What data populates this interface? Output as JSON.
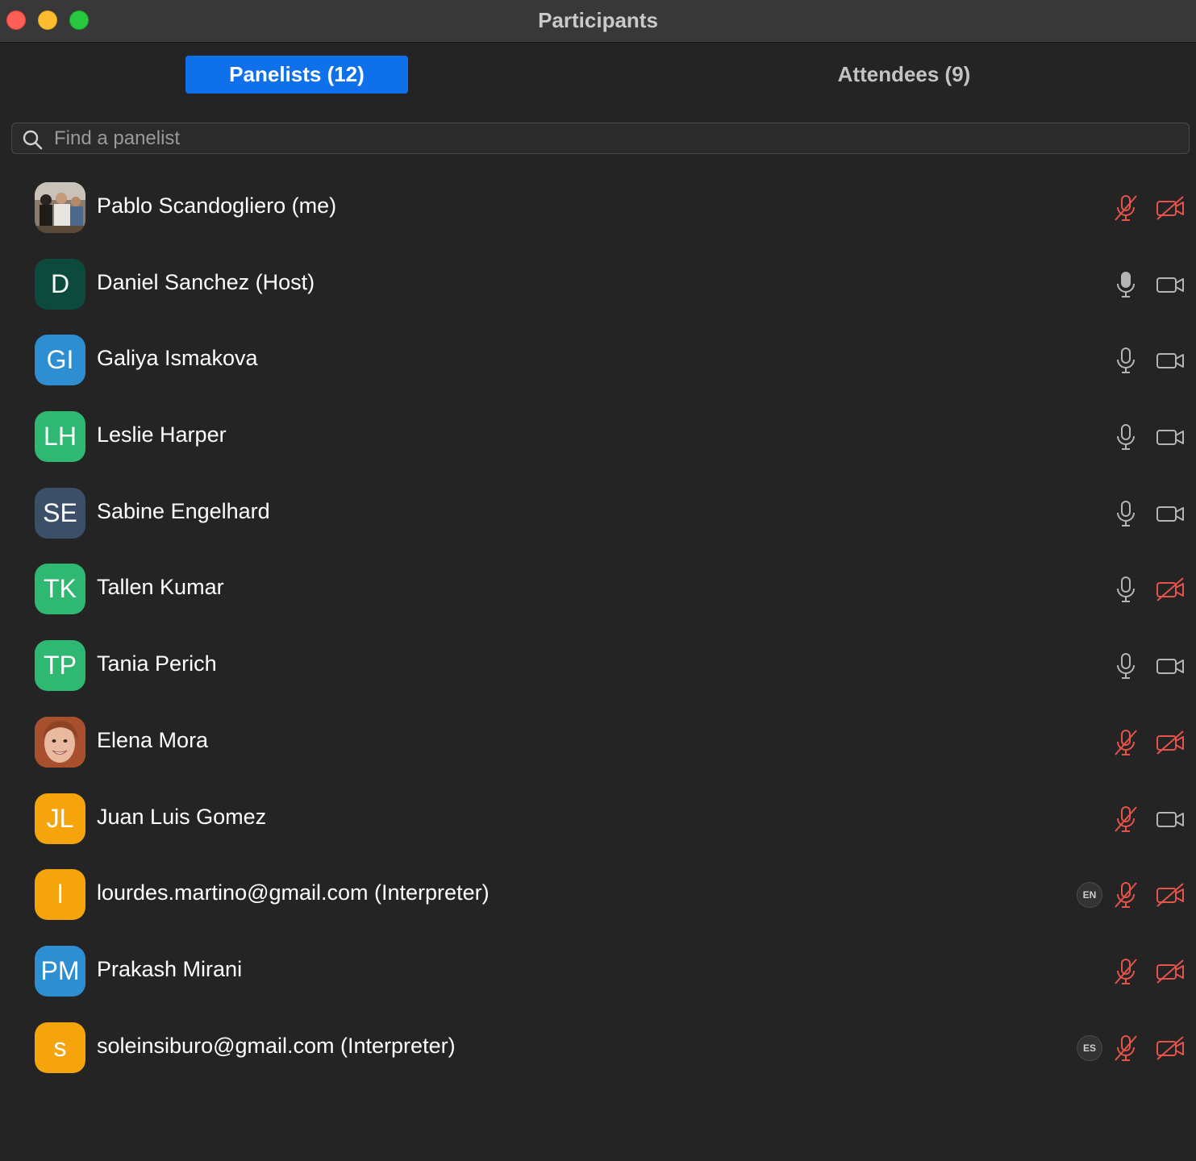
{
  "window": {
    "title": "Participants"
  },
  "tabs": {
    "panelists": "Panelists (12)",
    "attendees": "Attendees (9)"
  },
  "search": {
    "placeholder": "Find a panelist",
    "value": ""
  },
  "colors": {
    "accent": "#0e71eb",
    "muted_red": "#e5534b",
    "icon_gray": "#b5b5b5"
  },
  "participants": [
    {
      "name": "Pablo Scandogliero (me)",
      "avatar": "photo",
      "initials": "",
      "avatar_color": "",
      "mic_muted": true,
      "video_off": true,
      "language": ""
    },
    {
      "name": "Daniel Sanchez (Host)",
      "avatar": "initials",
      "initials": "D",
      "avatar_color": "#0b4a3d",
      "mic_muted": false,
      "mic_active": true,
      "video_off": false,
      "language": ""
    },
    {
      "name": "Galiya Ismakova",
      "avatar": "initials",
      "initials": "GI",
      "avatar_color": "#2d8fd1",
      "mic_muted": false,
      "video_off": false,
      "language": ""
    },
    {
      "name": "Leslie Harper",
      "avatar": "initials",
      "initials": "LH",
      "avatar_color": "#2eb872",
      "mic_muted": false,
      "video_off": false,
      "language": ""
    },
    {
      "name": "Sabine Engelhard",
      "avatar": "initials",
      "initials": "SE",
      "avatar_color": "#3b5068",
      "mic_muted": false,
      "video_off": false,
      "language": ""
    },
    {
      "name": "Tallen Kumar",
      "avatar": "initials",
      "initials": "TK",
      "avatar_color": "#2eb872",
      "mic_muted": false,
      "video_off": true,
      "language": ""
    },
    {
      "name": "Tania Perich",
      "avatar": "initials",
      "initials": "TP",
      "avatar_color": "#2eb872",
      "mic_muted": false,
      "video_off": false,
      "language": ""
    },
    {
      "name": "Elena Mora",
      "avatar": "photo",
      "initials": "",
      "avatar_color": "",
      "mic_muted": true,
      "video_off": true,
      "language": ""
    },
    {
      "name": "Juan Luis Gomez",
      "avatar": "initials",
      "initials": "JL",
      "avatar_color": "#f5a50b",
      "mic_muted": true,
      "video_off": false,
      "language": ""
    },
    {
      "name": "lourdes.martino@gmail.com (Interpreter)",
      "avatar": "initials",
      "initials": "l",
      "avatar_color": "#f5a50b",
      "mic_muted": true,
      "video_off": true,
      "language": "EN"
    },
    {
      "name": "Prakash Mirani",
      "avatar": "initials",
      "initials": "PM",
      "avatar_color": "#2d8fd1",
      "mic_muted": true,
      "video_off": true,
      "language": ""
    },
    {
      "name": "soleinsiburo@gmail.com (Interpreter)",
      "avatar": "initials",
      "initials": "s",
      "avatar_color": "#f5a50b",
      "mic_muted": true,
      "video_off": true,
      "language": "ES"
    }
  ]
}
